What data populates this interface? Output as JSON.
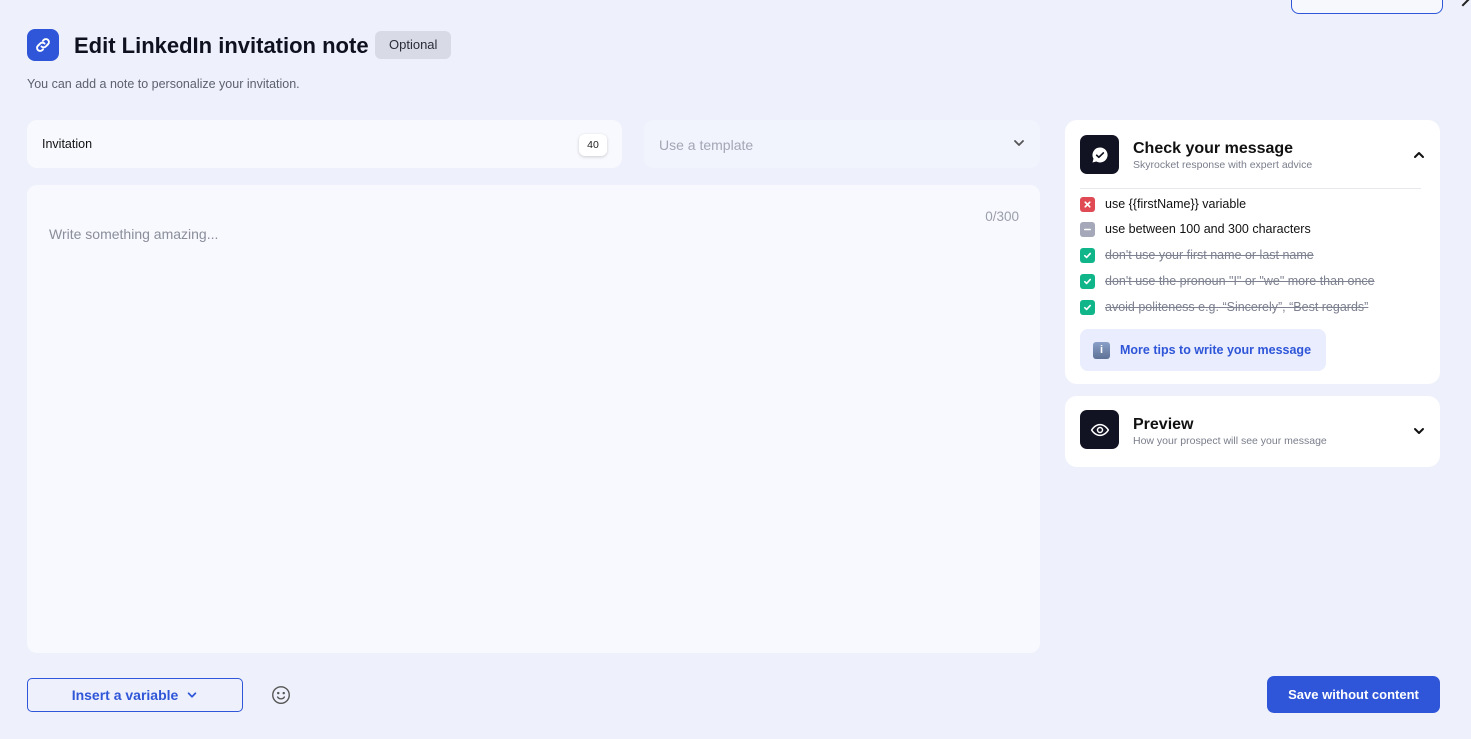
{
  "header": {
    "title": "Edit LinkedIn invitation note",
    "badge": "Optional",
    "subtitle": "You can add a note to personalize your invitation."
  },
  "name_field": {
    "value": "Invitation",
    "count": "40"
  },
  "template_select": {
    "placeholder": "Use a template"
  },
  "editor": {
    "placeholder": "Write something amazing...",
    "counter": "0/300"
  },
  "check_card": {
    "title": "Check your message",
    "subtitle": "Skyrocket response with expert advice",
    "rules": [
      {
        "text": "use {{firstName}} variable",
        "status": "failed"
      },
      {
        "text": "use between 100 and 300 characters",
        "status": "pending"
      },
      {
        "text": "don't use your first name or last name",
        "status": "passed"
      },
      {
        "text": "don't use the pronoun \"I\" or \"we\" more than once",
        "status": "passed"
      },
      {
        "text": "avoid politeness e.g. “Sincerely”, “Best regards”",
        "status": "passed"
      }
    ],
    "tips_label": "More tips to write your message"
  },
  "preview_card": {
    "title": "Preview",
    "subtitle": "How your prospect will see your message"
  },
  "footer": {
    "insert_variable_label": "Insert a variable",
    "save_label": "Save without content"
  },
  "colors": {
    "accent": "#2f56d8",
    "background": "#eef1fb",
    "failed": "#e04a55",
    "pending": "#a4a8b8",
    "passed": "#11b58a"
  },
  "icons": {
    "header": "link-icon",
    "check_card": "chat-bubble-check-icon",
    "preview_card": "eye-icon",
    "tips": "info-icon",
    "emoji": "smiley-icon"
  }
}
